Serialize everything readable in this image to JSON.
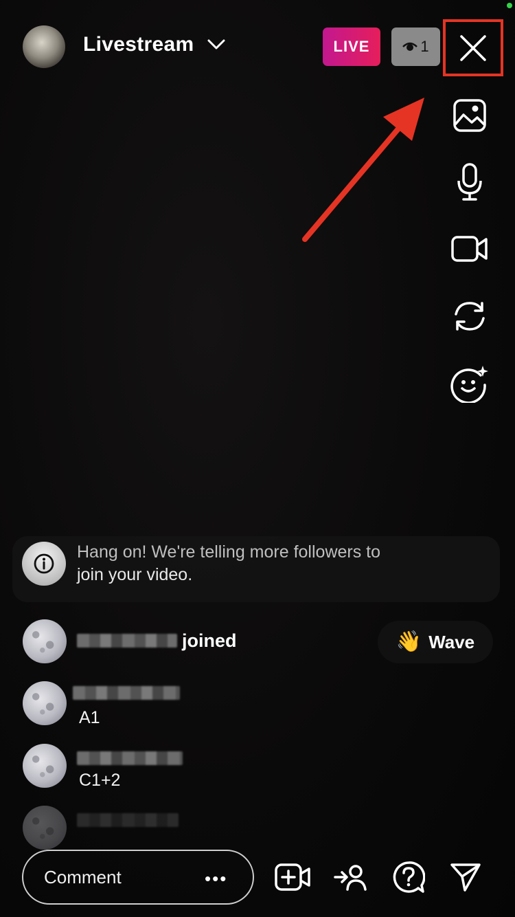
{
  "header": {
    "title": "Livestream",
    "live_label": "LIVE",
    "viewer_count": "1"
  },
  "info_banner": {
    "line1": "Hang on! We're telling more followers to",
    "line2": "join your video."
  },
  "comments": [
    {
      "type": "join",
      "text": "joined",
      "action_label": "Wave",
      "action_emoji": "👋"
    },
    {
      "type": "comment",
      "text": "A1"
    },
    {
      "type": "comment",
      "text": "C1+2"
    },
    {
      "type": "comment",
      "text": ""
    }
  ],
  "composer": {
    "placeholder": "Comment",
    "more": "•••"
  },
  "icons": {
    "right_tools": [
      "image-icon",
      "microphone-icon",
      "video-camera-icon",
      "flip-camera-icon",
      "face-effects-icon"
    ],
    "bottom_tools": [
      "add-video-icon",
      "invite-guest-icon",
      "question-icon",
      "send-icon"
    ]
  },
  "colors": {
    "live_gradient_start": "#c2188f",
    "live_gradient_end": "#e61e5b",
    "highlight": "#e53424"
  }
}
